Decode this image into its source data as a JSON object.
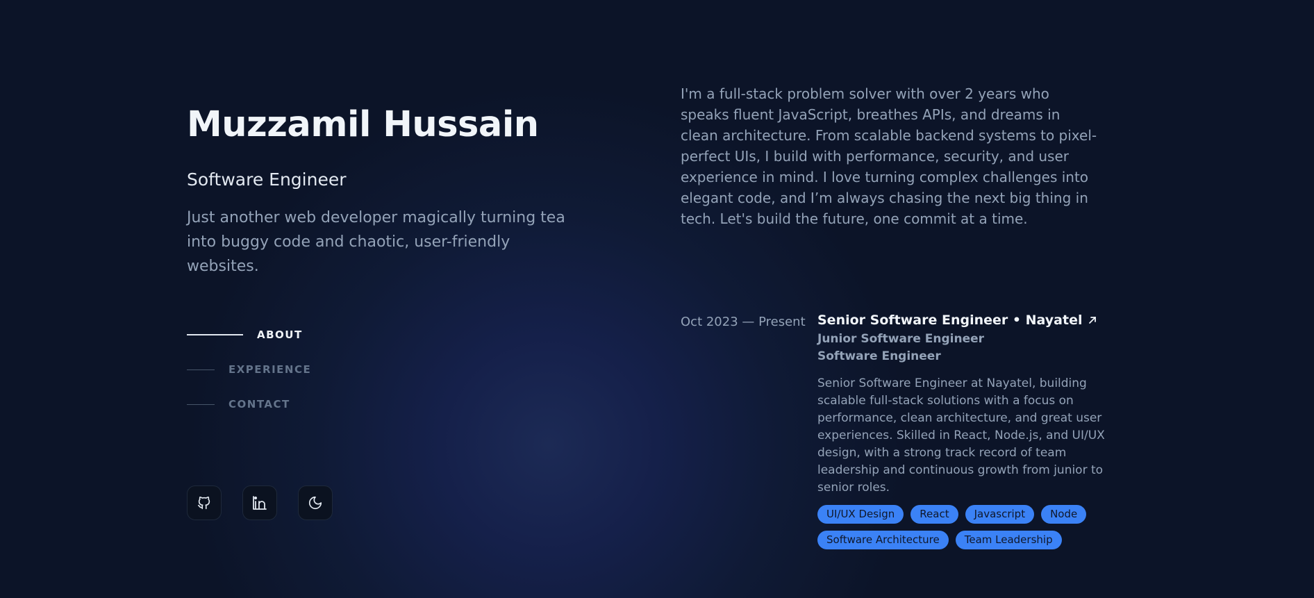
{
  "profile": {
    "name": "Muzzamil Hussain",
    "role": "Software Engineer",
    "tagline": "Just another web developer magically turning tea into buggy code and chaotic, user-friendly websites."
  },
  "nav": {
    "items": [
      {
        "label": "ABOUT",
        "active": true
      },
      {
        "label": "EXPERIENCE",
        "active": false
      },
      {
        "label": "CONTACT",
        "active": false
      }
    ]
  },
  "socials": {
    "icons": [
      "github-icon",
      "linkedin-icon",
      "moon-icon"
    ]
  },
  "about": {
    "text": "I'm a full-stack problem solver with over 2 years who speaks fluent JavaScript, breathes APIs, and dreams in clean architecture. From scalable backend systems to pixel-perfect UIs, I build with performance, security, and user experience in mind. I love turning complex challenges into elegant code, and I’m always chasing the next big thing in tech. Let's build the future, one commit at a time."
  },
  "experience": {
    "date": "Oct 2023 — Present",
    "title": "Senior Software Engineer • Nayatel",
    "previous_roles": [
      "Junior Software Engineer",
      "Software Engineer"
    ],
    "description": "Senior Software Engineer at Nayatel, building scalable full-stack solutions with a focus on performance, clean architecture, and great user experiences. Skilled in React, Node.js, and UI/UX design, with a strong track record of team leadership and continuous growth from junior to senior roles.",
    "tags": [
      "UI/UX Design",
      "React",
      "Javascript",
      "Node",
      "Software Architecture",
      "Team Leadership"
    ]
  },
  "colors": {
    "background": "#0f1a35",
    "accent": "#3b82f6",
    "text_primary": "#f1f5f9",
    "text_muted": "#94a3b8"
  }
}
